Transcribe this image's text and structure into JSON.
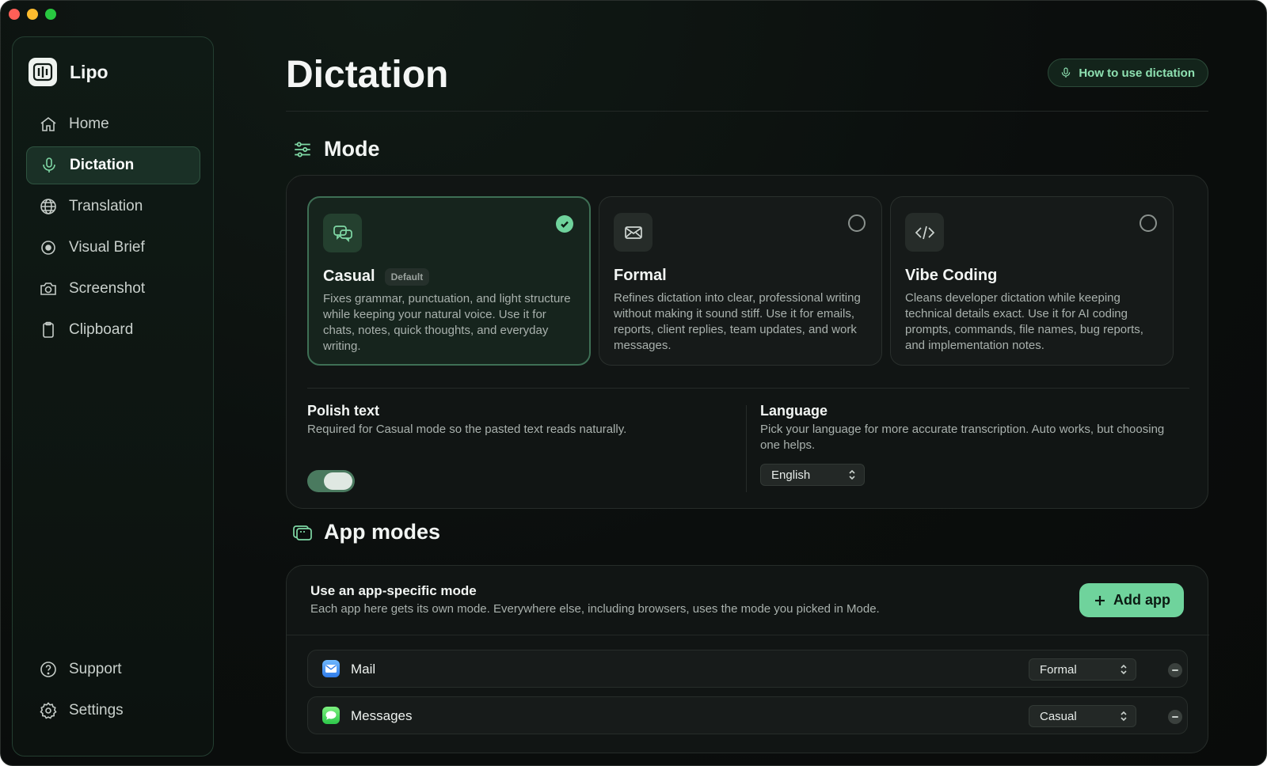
{
  "app": {
    "name": "Lipo"
  },
  "sidebar": {
    "items": [
      {
        "label": "Home",
        "icon": "home-icon",
        "active": false
      },
      {
        "label": "Dictation",
        "icon": "microphone-icon",
        "active": true
      },
      {
        "label": "Translation",
        "icon": "globe-icon",
        "active": false
      },
      {
        "label": "Visual Brief",
        "icon": "record-icon",
        "active": false
      },
      {
        "label": "Screenshot",
        "icon": "camera-icon",
        "active": false
      },
      {
        "label": "Clipboard",
        "icon": "clipboard-icon",
        "active": false
      }
    ],
    "bottom_items": [
      {
        "label": "Support",
        "icon": "help-icon"
      },
      {
        "label": "Settings",
        "icon": "gear-icon"
      }
    ]
  },
  "header": {
    "title": "Dictation",
    "help_button": "How to use dictation"
  },
  "mode_section": {
    "heading": "Mode",
    "cards": [
      {
        "name": "Casual",
        "badge": "Default",
        "selected": true,
        "icon": "chat-bubbles-icon",
        "description": "Fixes grammar, punctuation, and light structure while keeping your natural voice. Use it for chats, notes, quick thoughts, and everyday writing."
      },
      {
        "name": "Formal",
        "selected": false,
        "icon": "envelope-icon",
        "description": "Refines dictation into clear, professional writing without making it sound stiff. Use it for emails, reports, client replies, team updates, and work messages."
      },
      {
        "name": "Vibe Coding",
        "selected": false,
        "icon": "code-icon",
        "description": "Cleans developer dictation while keeping technical details exact. Use it for AI coding prompts, commands, file names, bug reports, and implementation notes."
      }
    ],
    "polish": {
      "title": "Polish text",
      "description": "Required for Casual mode so the pasted text reads naturally.",
      "enabled": true
    },
    "language": {
      "title": "Language",
      "description": "Pick your language for more accurate transcription. Auto works, but choosing one helps.",
      "selected": "English"
    }
  },
  "app_modes": {
    "heading": "App modes",
    "title": "Use an app-specific mode",
    "description": "Each app here gets its own mode. Everywhere else, including browsers, uses the mode you picked in Mode.",
    "add_button": "Add app",
    "apps": [
      {
        "name": "Mail",
        "mode": "Formal"
      },
      {
        "name": "Messages",
        "mode": "Casual"
      }
    ]
  },
  "colors": {
    "accent": "#6fd39c",
    "background": "#0b0e0d",
    "active_nav": "#1a3026"
  }
}
